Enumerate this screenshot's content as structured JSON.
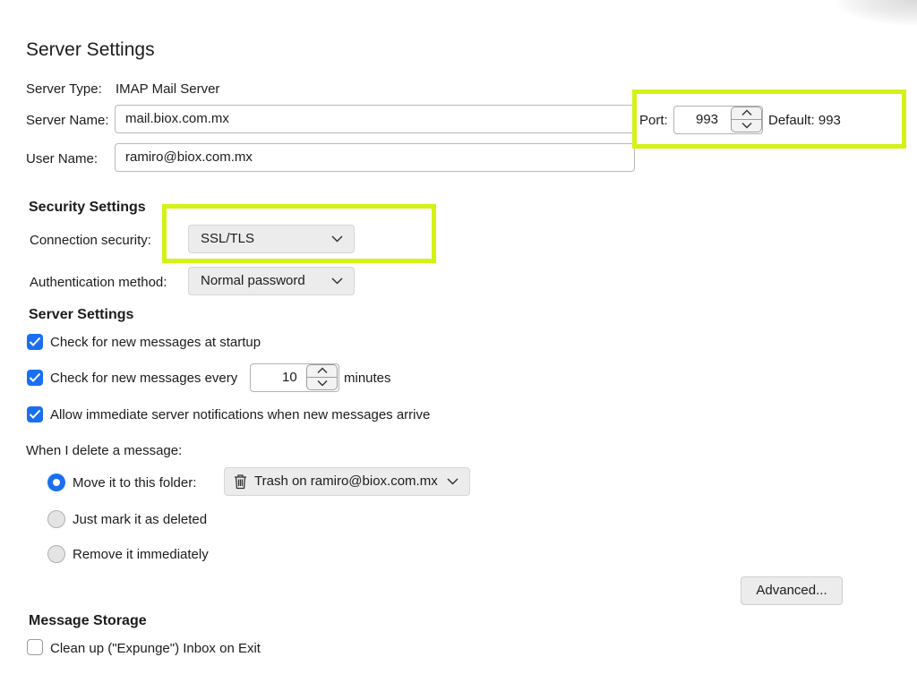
{
  "page_title": "Server Settings",
  "server": {
    "type_label": "Server Type:",
    "type_value": "IMAP Mail Server",
    "name_label": "Server Name:",
    "name_value": "mail.biox.com.mx",
    "port_label": "Port:",
    "port_value": "993",
    "default_label": "Default: 993",
    "user_label": "User Name:",
    "user_value": "ramiro@biox.com.mx"
  },
  "security": {
    "heading": "Security Settings",
    "connection_label": "Connection security:",
    "connection_value": "SSL/TLS",
    "auth_label": "Authentication method:",
    "auth_value": "Normal password"
  },
  "server_settings": {
    "heading": "Server Settings",
    "check_startup": {
      "label": "Check for new messages at startup",
      "checked": true
    },
    "check_every": {
      "label": "Check for new messages every",
      "value": "10",
      "unit": "minutes",
      "checked": true
    },
    "notifications": {
      "label": "Allow immediate server notifications when new messages arrive",
      "checked": true
    },
    "delete_label": "When I delete a message:",
    "delete_options": [
      {
        "label": "Move it to this folder:",
        "selected": true
      },
      {
        "label": "Just mark it as deleted",
        "selected": false
      },
      {
        "label": "Remove it immediately",
        "selected": false
      }
    ],
    "trash_folder": "Trash on ramiro@biox.com.mx",
    "advanced_button": "Advanced..."
  },
  "message_storage": {
    "heading": "Message Storage",
    "expunge": {
      "label": "Clean up (\"Expunge\") Inbox on Exit",
      "checked": false
    }
  },
  "icons": {
    "trash": "trash-icon",
    "chevron": "chevron-down-icon",
    "checkmark": "checkmark-icon",
    "spin_up": "chevron-up-icon",
    "spin_down": "chevron-down-icon"
  },
  "colors": {
    "accent": "#1a6ff0",
    "highlight": "#d4f216"
  }
}
